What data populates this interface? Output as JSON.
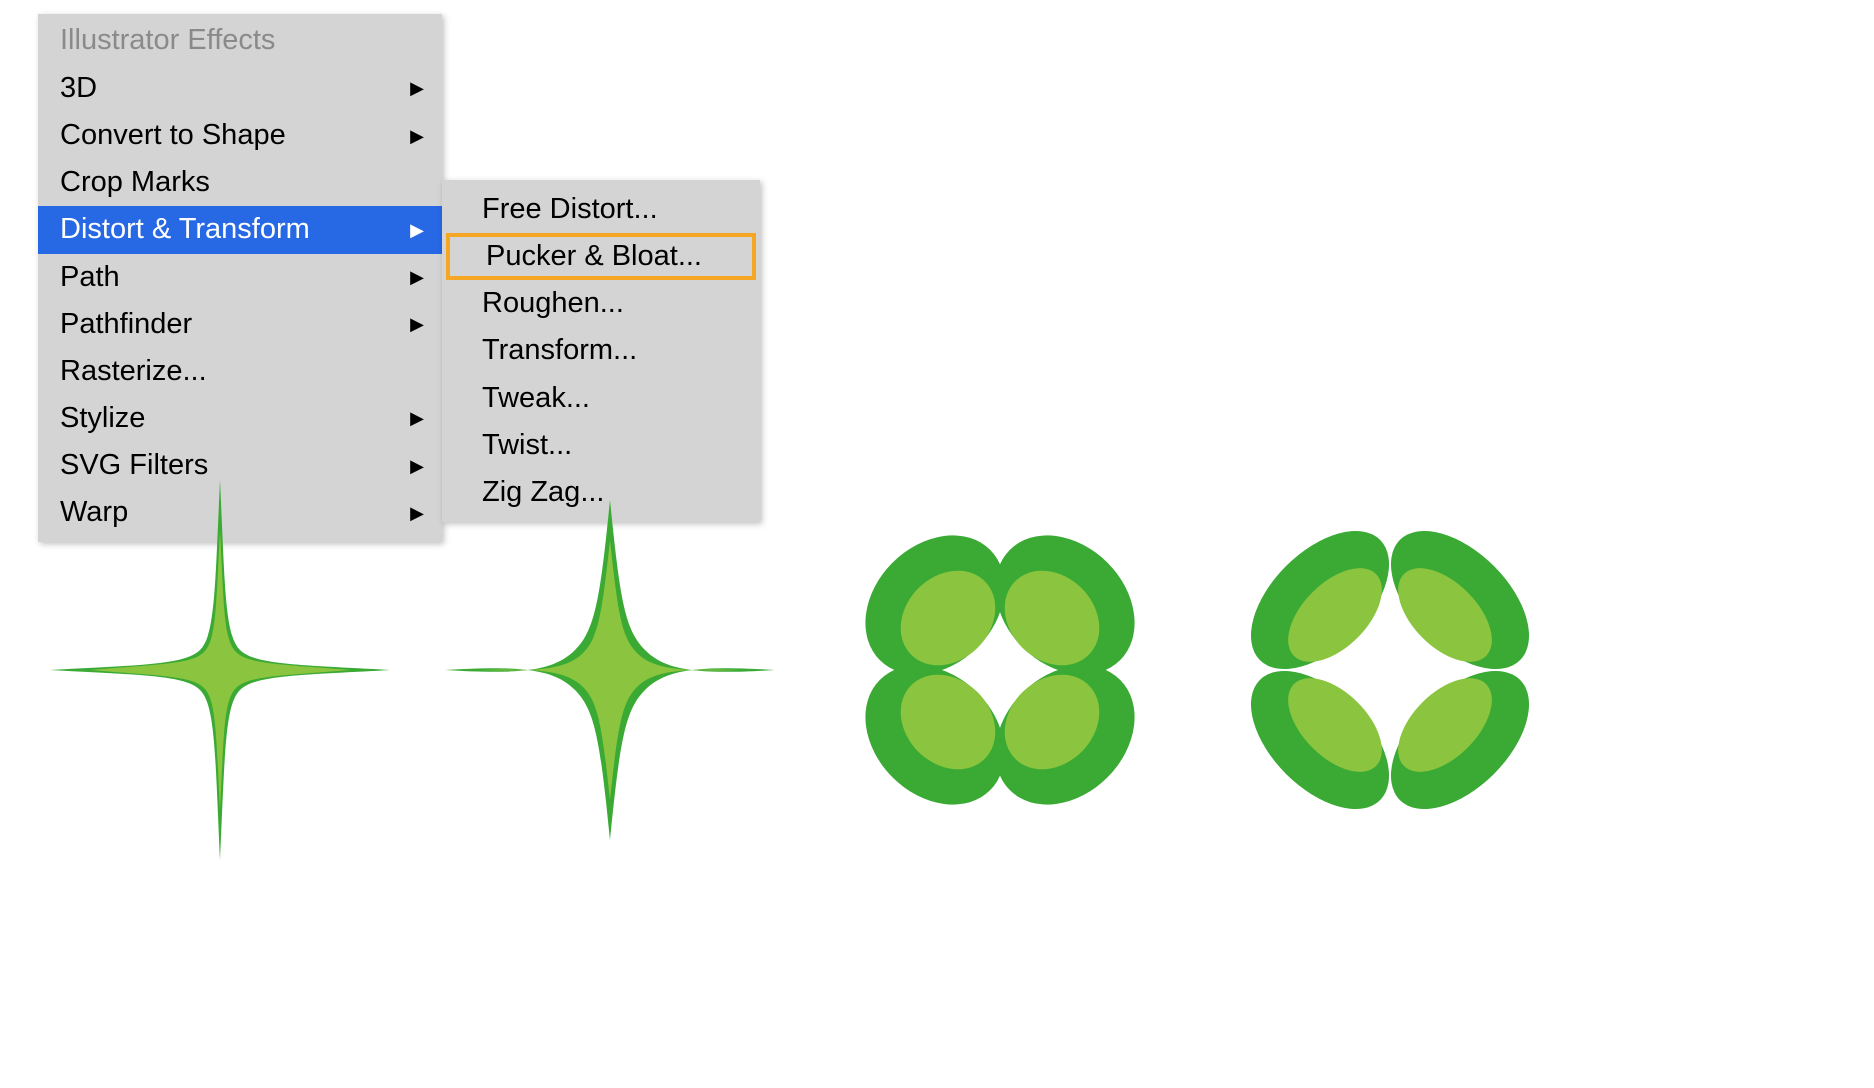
{
  "menu": {
    "header": "Illustrator Effects",
    "items": [
      {
        "label": "3D",
        "hasSubmenu": true,
        "selected": false
      },
      {
        "label": "Convert to Shape",
        "hasSubmenu": true,
        "selected": false
      },
      {
        "label": "Crop Marks",
        "hasSubmenu": false,
        "selected": false
      },
      {
        "label": "Distort & Transform",
        "hasSubmenu": true,
        "selected": true
      },
      {
        "label": "Path",
        "hasSubmenu": true,
        "selected": false
      },
      {
        "label": "Pathfinder",
        "hasSubmenu": true,
        "selected": false
      },
      {
        "label": "Rasterize...",
        "hasSubmenu": false,
        "selected": false
      },
      {
        "label": "Stylize",
        "hasSubmenu": true,
        "selected": false
      },
      {
        "label": "SVG Filters",
        "hasSubmenu": true,
        "selected": false
      },
      {
        "label": "Warp",
        "hasSubmenu": true,
        "selected": false
      }
    ]
  },
  "submenu": {
    "items": [
      {
        "label": "Free Distort...",
        "highlighted": false
      },
      {
        "label": "Pucker & Bloat...",
        "highlighted": true
      },
      {
        "label": "Roughen...",
        "highlighted": false
      },
      {
        "label": "Transform...",
        "highlighted": false
      },
      {
        "label": "Tweak...",
        "highlighted": false
      },
      {
        "label": "Twist...",
        "highlighted": false
      },
      {
        "label": "Zig Zag...",
        "highlighted": false
      }
    ]
  },
  "colors": {
    "darkGreen": "#3aaa35",
    "lightGreen": "#8bc53f",
    "menuBg": "#d4d4d4",
    "menuSelected": "#2768e5",
    "highlight": "#f5a623"
  }
}
